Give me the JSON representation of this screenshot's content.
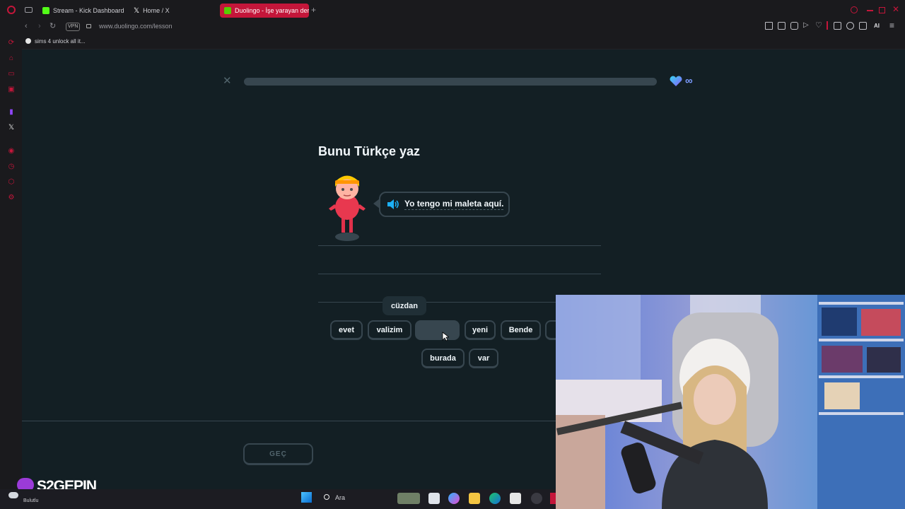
{
  "browser": {
    "tabs": [
      {
        "title": "Stream - Kick Dashboard",
        "favicon": "kick-icon",
        "color": "#53fc18"
      },
      {
        "title": "Home / X",
        "favicon": "x-icon",
        "color": "#ffffff"
      },
      {
        "title": "Duolingo - İşe yarayan der",
        "favicon": "duolingo-icon",
        "color": "#58cc02"
      }
    ],
    "url": "www.duolingo.com/lesson",
    "vpn_label": "VPN",
    "bookmark": "sims 4 unlock all it...",
    "aria_label": "AI"
  },
  "lesson": {
    "title": "Bunu Türkçe yaz",
    "sentence": "Yo tengo mi maleta aquí.",
    "hearts": "∞",
    "progress": 0.0,
    "tooltip": "cüzdan",
    "word_bank_row1": [
      "evet",
      "valizim",
      "",
      "yeni",
      "Bende"
    ],
    "word_bank_row2": [
      "burada",
      "var"
    ],
    "skip_label": "GEÇ"
  },
  "overlay": {
    "brand": "S2GEPIN"
  },
  "taskbar": {
    "search_label": "Ara",
    "weather_label": "Bulutlu"
  },
  "colors": {
    "background": "#131f24",
    "border": "#37464f",
    "text": "#f1f7fb",
    "accent_opera": "#c4163a",
    "speaker_blue": "#1cb0f6"
  }
}
